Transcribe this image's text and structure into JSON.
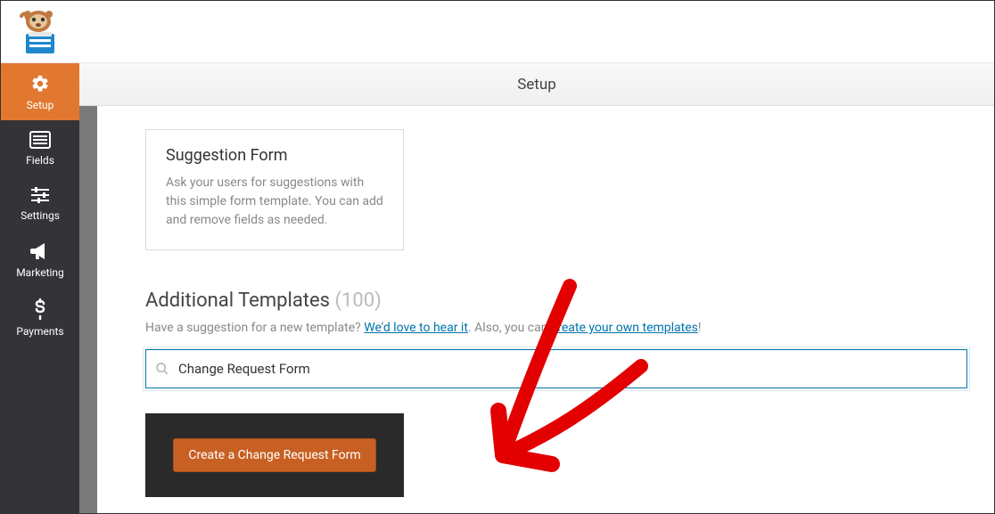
{
  "header": {
    "title": "Setup"
  },
  "sidebar": {
    "items": [
      {
        "label": "Setup",
        "active": true
      },
      {
        "label": "Fields",
        "active": false
      },
      {
        "label": "Settings",
        "active": false
      },
      {
        "label": "Marketing",
        "active": false
      },
      {
        "label": "Payments",
        "active": false
      }
    ]
  },
  "template_card": {
    "title": "Suggestion Form",
    "desc": "Ask your users for suggestions with this simple form template. You can add and remove fields as needed."
  },
  "additional": {
    "title": "Additional Templates",
    "count": "(100)",
    "prompt_pre": "Have a suggestion for a new template? ",
    "link1": "We'd love to hear it",
    "mid": ". Also, you can ",
    "link2": "create your own templates",
    "post": "!"
  },
  "search": {
    "value": "Change Request Form"
  },
  "result": {
    "button": "Create a Change Request Form"
  }
}
